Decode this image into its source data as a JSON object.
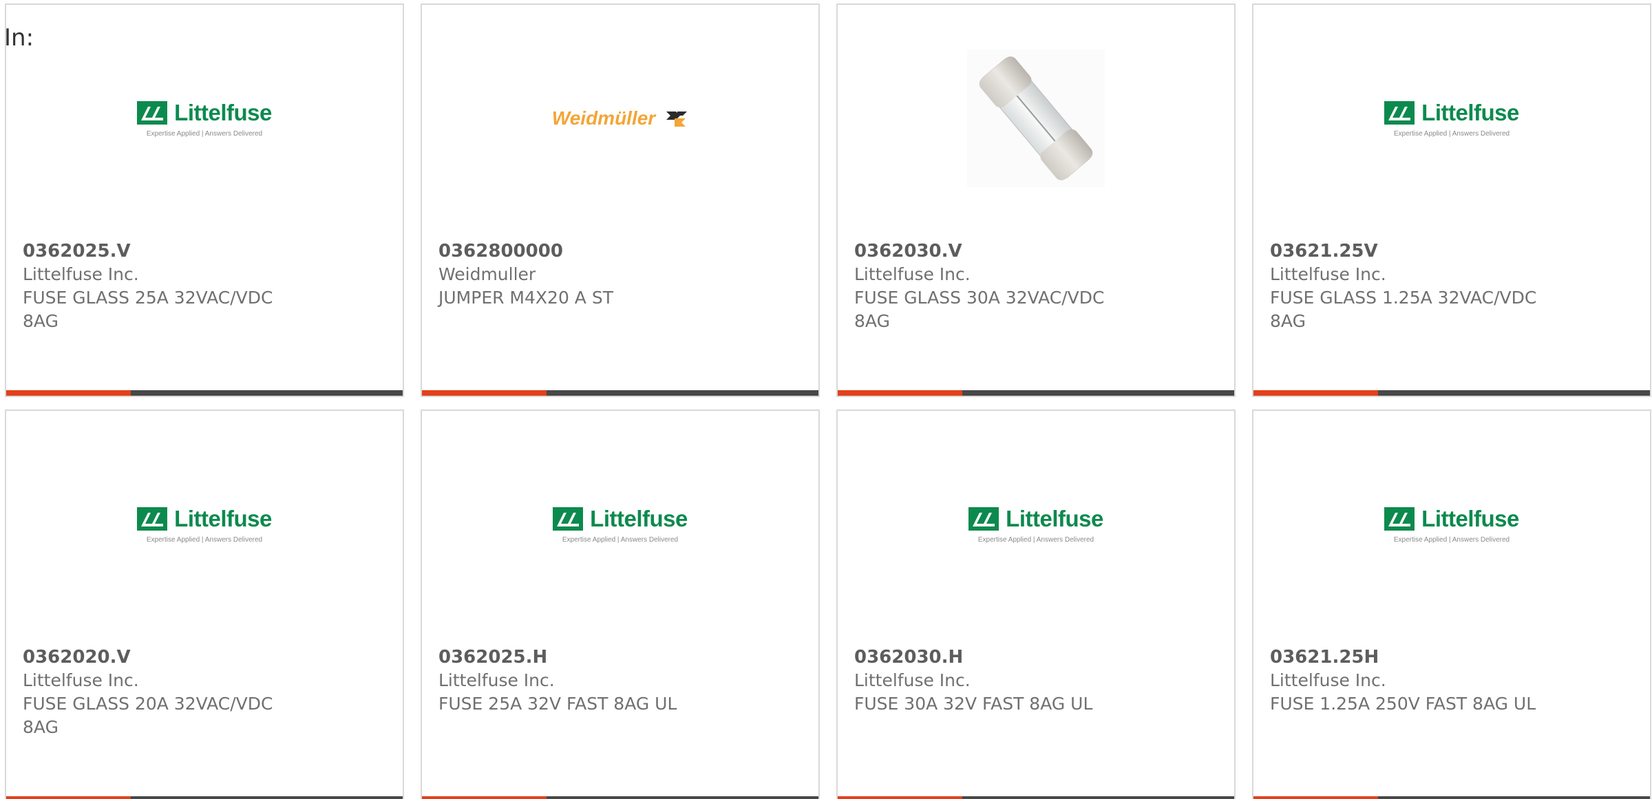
{
  "filter_label": "In:",
  "logos": {
    "littelfuse_word": "Littelfuse",
    "littelfuse_tagline": "Expertise Applied | Answers Delivered",
    "weidmuller_word": "Weidmüller"
  },
  "colors": {
    "accent": "#e2411c",
    "bar": "#484848",
    "littelfuse_green": "#0c8a4e",
    "weidmuller_orange": "#f3a537"
  },
  "products": [
    {
      "part_number": "0362025.V",
      "manufacturer": "Littelfuse Inc.",
      "description": "FUSE GLASS 25A 32VAC/VDC 8AG",
      "image": "littelfuse-logo"
    },
    {
      "part_number": "0362800000",
      "manufacturer": "Weidmuller",
      "description": "JUMPER M4X20 A ST",
      "image": "weidmuller-logo"
    },
    {
      "part_number": "0362030.V",
      "manufacturer": "Littelfuse Inc.",
      "description": "FUSE GLASS 30A 32VAC/VDC 8AG",
      "image": "glass-fuse-photo"
    },
    {
      "part_number": "03621.25V",
      "manufacturer": "Littelfuse Inc.",
      "description": "FUSE GLASS 1.25A 32VAC/VDC 8AG",
      "image": "littelfuse-logo"
    },
    {
      "part_number": "0362020.V",
      "manufacturer": "Littelfuse Inc.",
      "description": "FUSE GLASS 20A 32VAC/VDC 8AG",
      "image": "littelfuse-logo"
    },
    {
      "part_number": "0362025.H",
      "manufacturer": "Littelfuse Inc.",
      "description": "FUSE 25A 32V FAST 8AG UL",
      "image": "littelfuse-logo"
    },
    {
      "part_number": "0362030.H",
      "manufacturer": "Littelfuse Inc.",
      "description": "FUSE 30A 32V FAST 8AG UL",
      "image": "littelfuse-logo"
    },
    {
      "part_number": "03621.25H",
      "manufacturer": "Littelfuse Inc.",
      "description": "FUSE 1.25A 250V FAST 8AG UL",
      "image": "littelfuse-logo"
    }
  ]
}
